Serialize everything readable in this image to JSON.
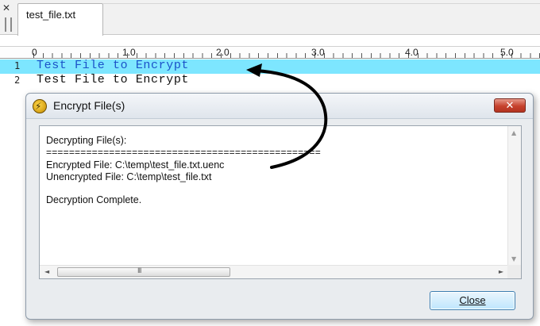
{
  "editor": {
    "tab": {
      "close_glyph": "✕",
      "title": "test_file.txt"
    },
    "ruler": {
      "labels": [
        "0",
        "1.0",
        "2.0",
        "3.0",
        "4.0",
        "5.0"
      ]
    },
    "lines": [
      {
        "number": "1",
        "text": "Test File to Encrypt"
      },
      {
        "number": "2",
        "text": "Test File to Encrypt"
      }
    ],
    "current_line_color": "#7de6ff"
  },
  "dialog": {
    "title": "Encrypt File(s)",
    "app_icon": "encrypt-tool-icon",
    "close_glyph": "✕",
    "output": {
      "lines": [
        "Decrypting File(s):",
        "================================================",
        "Encrypted File: C:\\temp\\test_file.txt.uenc",
        "Unencrypted File: C:\\temp\\test_file.txt",
        "Decryption Complete."
      ]
    },
    "scrollbar": {
      "up": "▲",
      "down": "▼",
      "left": "◄",
      "right": "►",
      "grip": "III"
    },
    "close_button": "Close"
  },
  "colors": {
    "arrow": "#000000",
    "accent": "#3c7fb1"
  }
}
